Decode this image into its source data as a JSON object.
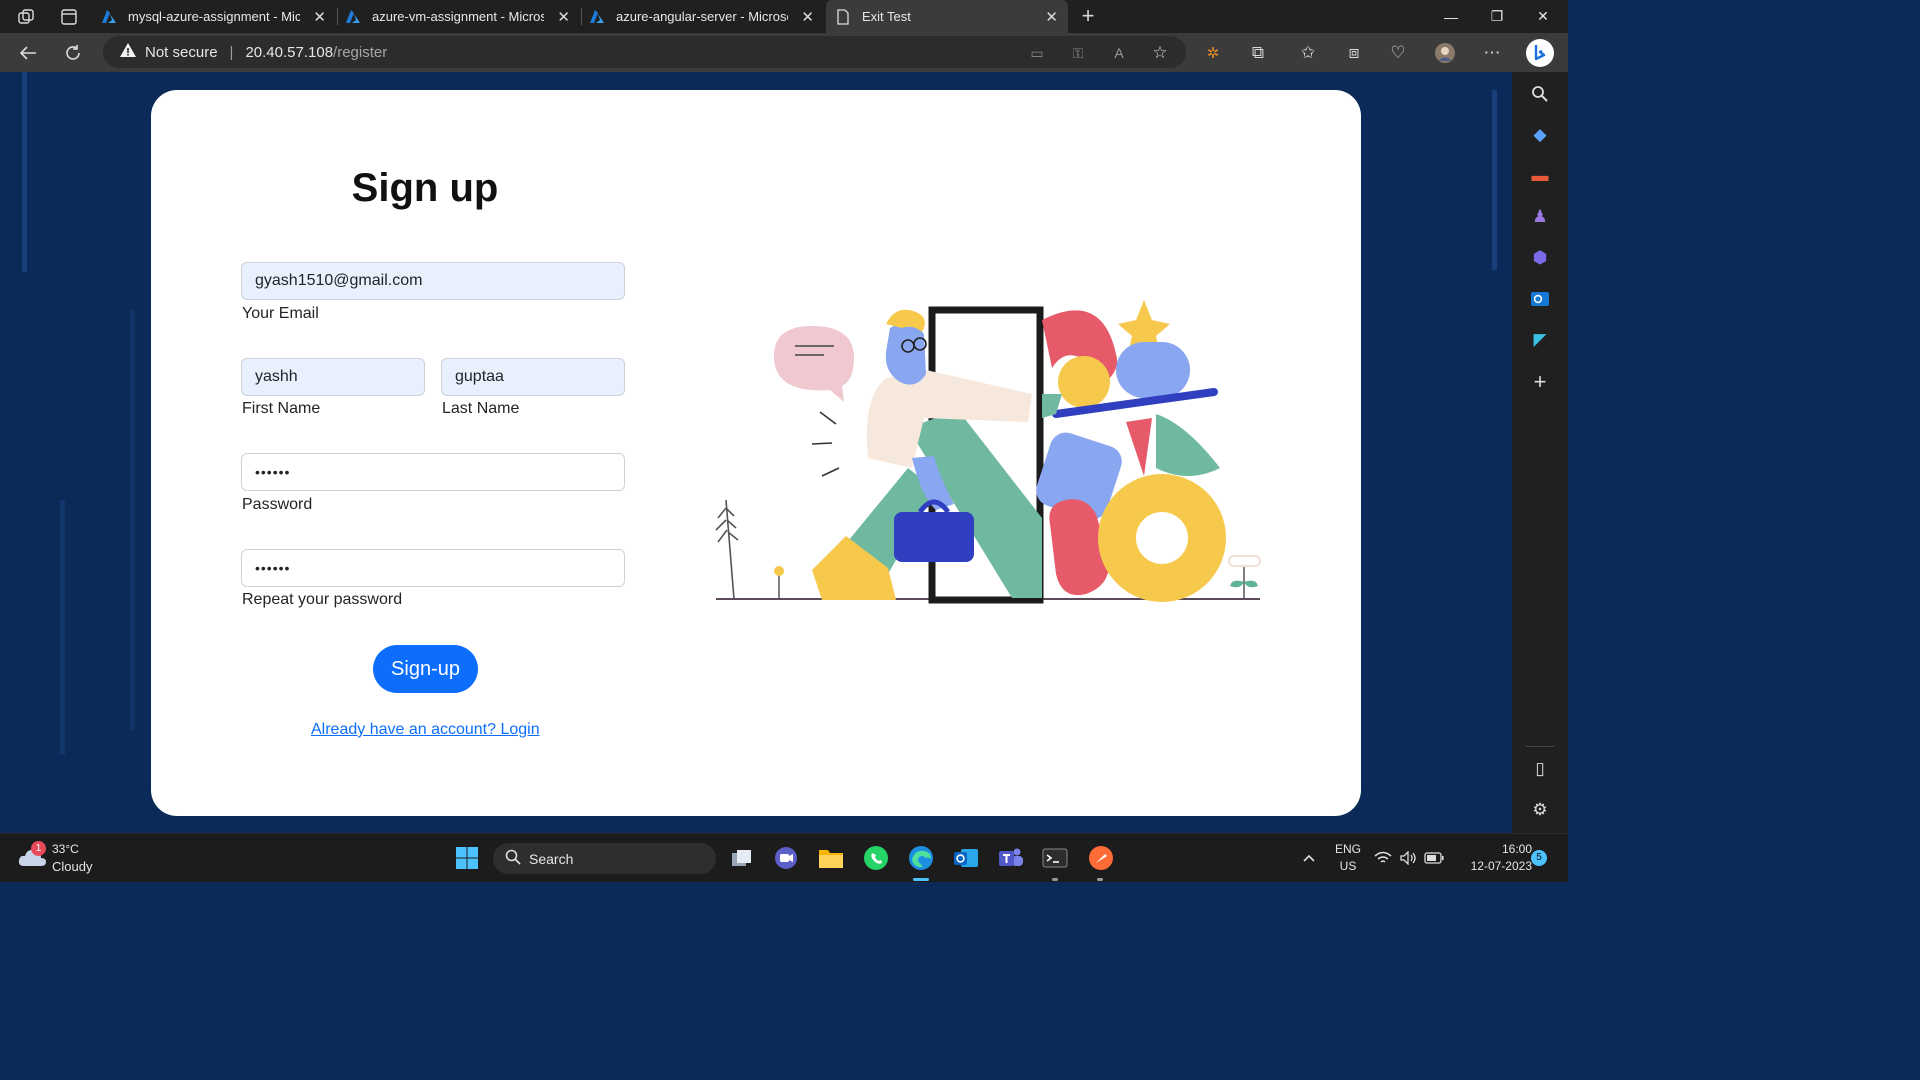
{
  "browser": {
    "tabs": [
      {
        "title": "mysql-azure-assignment - Micro",
        "icon": "azure-logo-icon"
      },
      {
        "title": "azure-vm-assignment - Microsof",
        "icon": "azure-logo-icon"
      },
      {
        "title": "azure-angular-server - Microsoft",
        "icon": "azure-logo-icon"
      },
      {
        "title": "Exit Test",
        "icon": "page-icon",
        "active": true
      }
    ],
    "address": {
      "security": "Not secure",
      "host": "20.40.57.108",
      "path": "/register"
    }
  },
  "form": {
    "title": "Sign up",
    "email": {
      "value": "gyash1510@gmail.com",
      "label": "Your Email"
    },
    "first_name": {
      "value": "yashh",
      "label": "First Name"
    },
    "last_name": {
      "value": "guptaa",
      "label": "Last Name"
    },
    "password": {
      "value": "••••••",
      "label": "Password"
    },
    "repeat_password": {
      "value": "••••••",
      "label": "Repeat your password"
    },
    "submit_label": "Sign-up",
    "login_link": "Already have an account? Login"
  },
  "taskbar": {
    "weather": {
      "temp": "33°C",
      "condition": "Cloudy",
      "badge": "1"
    },
    "search_label": "Search",
    "language": {
      "lang": "ENG",
      "region": "US"
    },
    "clock": {
      "time": "16:00",
      "date": "12-07-2023"
    },
    "notifications": "5"
  },
  "colors": {
    "page_bg": "#0b2a57",
    "accent": "#0d6efd",
    "autofill": "#e8f0fe"
  }
}
